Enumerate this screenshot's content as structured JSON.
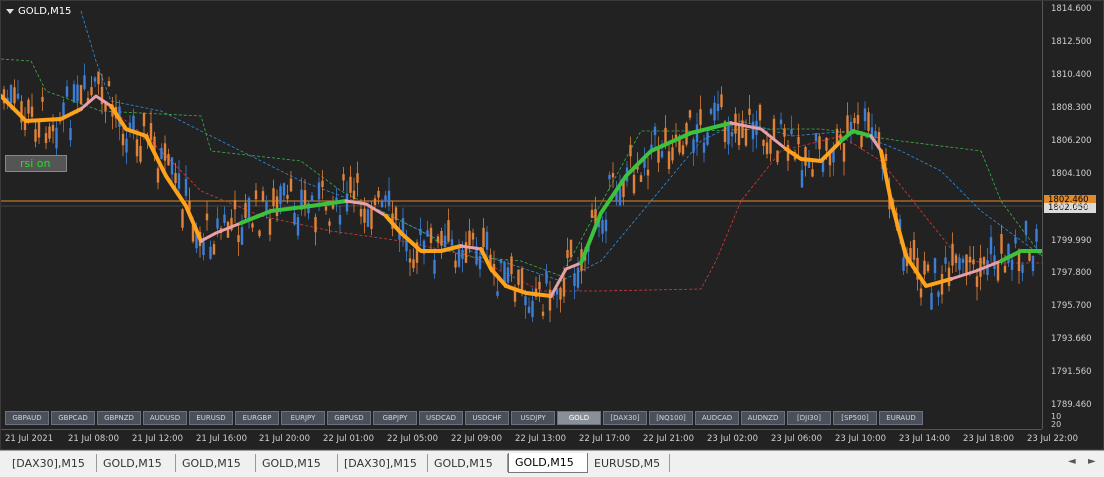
{
  "window": {
    "symbol_title": "GOLD,M15"
  },
  "rsi_button": {
    "label": "rsi on"
  },
  "price_axis": {
    "labels": [
      "1814.600",
      "1812.500",
      "1810.400",
      "1808.300",
      "1806.200",
      "1804.100",
      "1802.050",
      "1799.990",
      "1797.800",
      "1795.700",
      "1793.660",
      "1791.560",
      "1789.460"
    ],
    "ask": "1802.460",
    "bid": "1802.050"
  },
  "time_axis": {
    "labels": [
      "21 Jul 2021",
      "21 Jul 08:00",
      "21 Jul 12:00",
      "21 Jul 16:00",
      "21 Jul 20:00",
      "22 Jul 01:00",
      "22 Jul 05:00",
      "22 Jul 09:00",
      "22 Jul 13:00",
      "22 Jul 17:00",
      "22 Jul 21:00",
      "23 Jul 02:00",
      "23 Jul 06:00",
      "23 Jul 10:00",
      "23 Jul 14:00",
      "23 Jul 18:00",
      "23 Jul 22:00"
    ],
    "corner_top": "10",
    "corner_bottom": "20"
  },
  "symbol_buttons": [
    "GBPAUD",
    "GBPCAD",
    "GBPNZD",
    "AUDUSD",
    "EURUSD",
    "EURGBP",
    "EURJPY",
    "GBPUSD",
    "GBPJPY",
    "USDCAD",
    "USDCHF",
    "USDJPY",
    "GOLD",
    "[DAX30]",
    "[NQ100]",
    "AUDCAD",
    "AUDNZD",
    "[DJI30]",
    "[SP500]",
    "EURAUD"
  ],
  "active_symbol": "GOLD",
  "tabs": [
    "[DAX30],M15",
    "GOLD,M15",
    "GOLD,M15",
    "GOLD,M15",
    "[DAX30],M15",
    "GOLD,M15",
    "GOLD,M15",
    "EURUSD,M5"
  ],
  "active_tab_index": 6,
  "colors": {
    "bull_candle": "#3d7fd6",
    "bear_candle": "#e0823a",
    "ma_down": "#ffa31a",
    "ma_up": "#3cc23c",
    "ma_neutral": "#e8a0a8",
    "price_line": "#e08a2c",
    "background": "#222222"
  }
}
